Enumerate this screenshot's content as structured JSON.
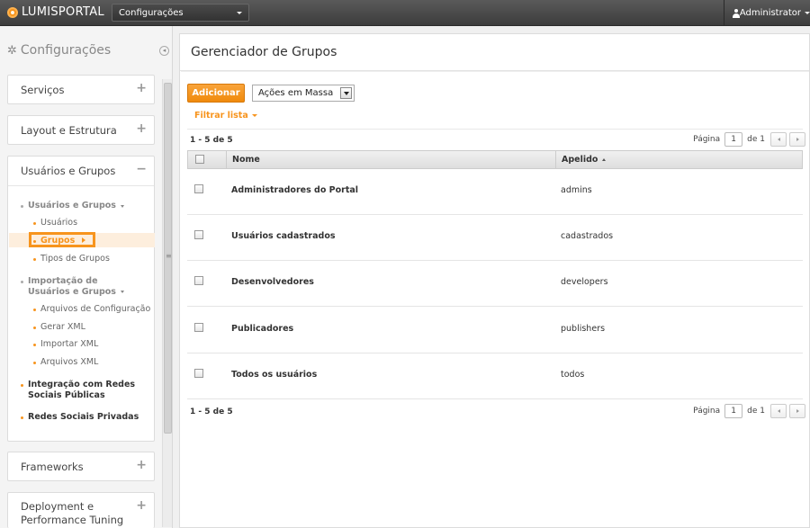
{
  "topbar": {
    "logo_text": "LUMISPORTAL",
    "site_select": "Configurações",
    "user_name": "Administrator"
  },
  "sidebar": {
    "title": "Configurações",
    "panels": [
      {
        "label": "Serviços",
        "toggle": "+"
      },
      {
        "label": "Layout e Estrutura",
        "toggle": "+"
      },
      {
        "label": "Usuários e Grupos",
        "toggle": "−"
      },
      {
        "label": "Frameworks",
        "toggle": "+"
      },
      {
        "label": "Deployment e Performance Tuning",
        "toggle": "+"
      }
    ],
    "tree": {
      "group1": "Usuários e Grupos",
      "usuarios": "Usuários",
      "grupos": "Grupos",
      "tipos_grupos": "Tipos de Grupos",
      "group2": "Importação de Usuários e Grupos",
      "arquivos_config": "Arquivos de Configuração",
      "gerar_xml": "Gerar XML",
      "importar_xml": "Importar XML",
      "arquivos_xml": "Arquivos XML",
      "integracao": "Integração com Redes Sociais Públicas",
      "redes_privadas": "Redes Sociais Privadas"
    }
  },
  "main": {
    "title": "Gerenciador de Grupos",
    "add_button": "Adicionar",
    "bulk_actions": "Ações em Massa",
    "filter_link": "Filtrar lista",
    "count_label": "1 - 5 de 5",
    "pager": {
      "page_label": "Página",
      "page_value": "1",
      "of_label": "de 1"
    },
    "columns": {
      "name": "Nome",
      "nickname": "Apelido"
    },
    "rows": [
      {
        "name": "Administradores do Portal",
        "nickname": "admins"
      },
      {
        "name": "Usuários cadastrados",
        "nickname": "cadastrados"
      },
      {
        "name": "Desenvolvedores",
        "nickname": "developers"
      },
      {
        "name": "Publicadores",
        "nickname": "publishers"
      },
      {
        "name": "Todos os usuários",
        "nickname": "todos"
      }
    ]
  },
  "colors": {
    "accent": "#f7941d",
    "topbar": "#4a4a4a"
  }
}
